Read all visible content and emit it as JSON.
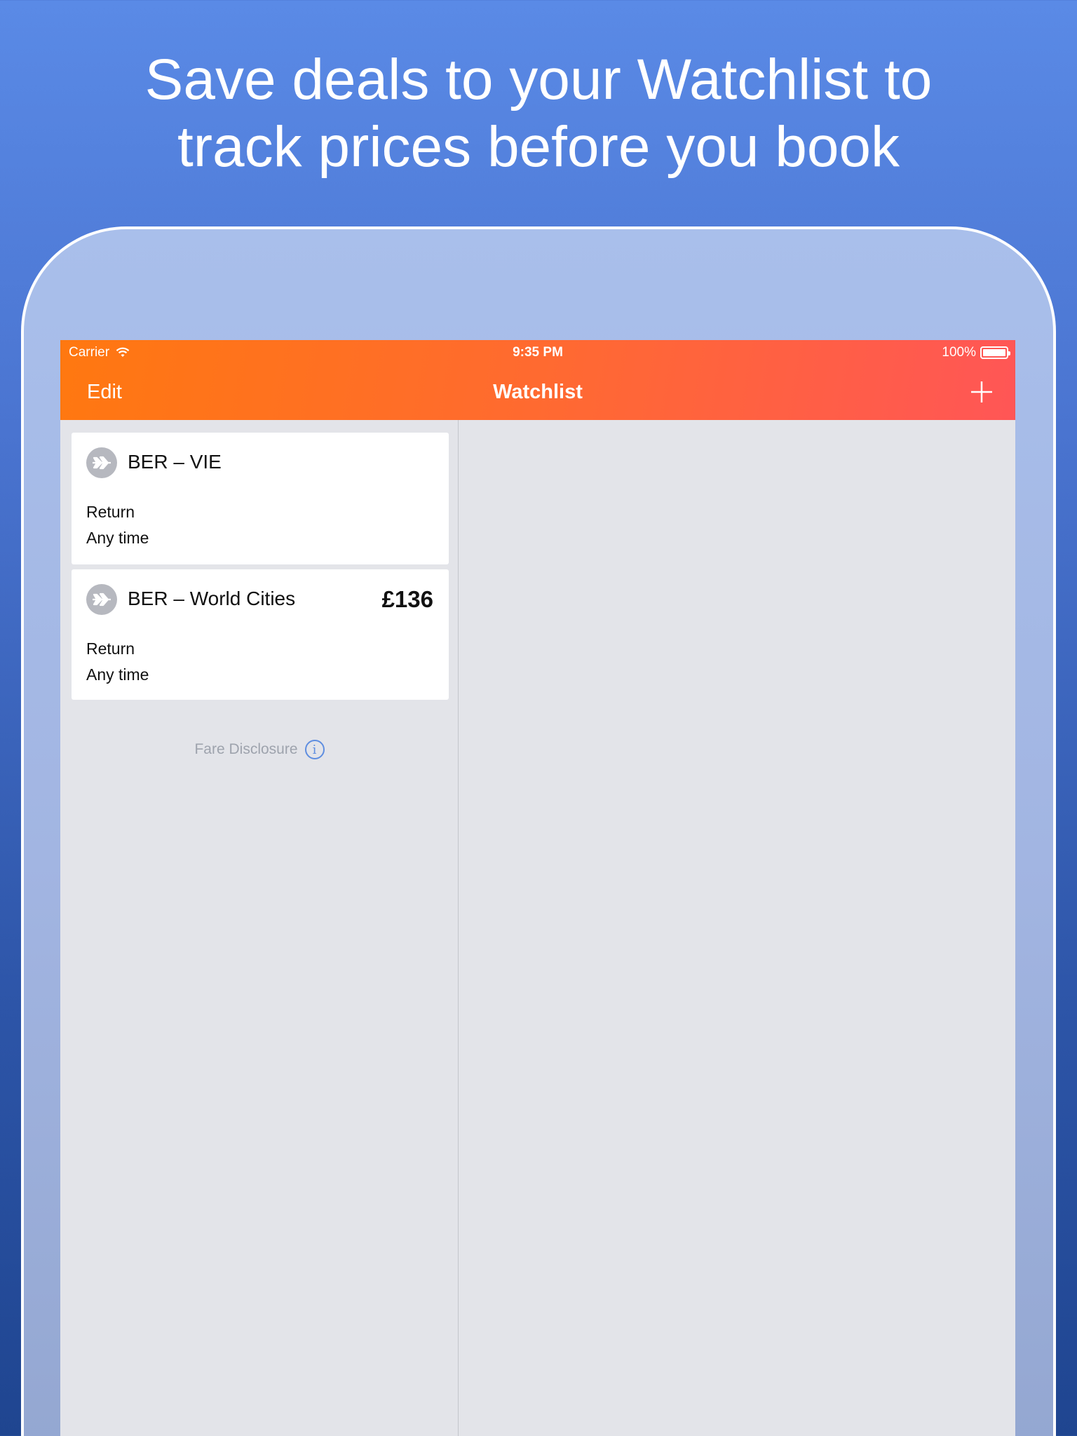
{
  "headline": {
    "line1": "Save deals to your Watchlist to",
    "line2": "track prices before you book"
  },
  "status_bar": {
    "carrier": "Carrier",
    "time": "9:35 PM",
    "battery": "100%"
  },
  "nav": {
    "edit_label": "Edit",
    "title": "Watchlist",
    "add_icon": "plus-icon"
  },
  "watchlist": [
    {
      "route": "BER – VIE",
      "price": "",
      "trip_type": "Return",
      "when": "Any time",
      "icon": "plane-icon"
    },
    {
      "route": "BER – World Cities",
      "price": "£136",
      "trip_type": "Return",
      "when": "Any time",
      "icon": "plane-icon"
    }
  ],
  "footer": {
    "fare_disclosure": "Fare Disclosure",
    "info_icon": "info-icon"
  },
  "colors": {
    "background_top": "#5a8ae6",
    "background_bottom": "#1f4590",
    "navbar_start": "#ff7810",
    "navbar_end": "#ff5656",
    "pane_bg": "#e3e4e9",
    "accent_blue": "#5f8ee0"
  }
}
